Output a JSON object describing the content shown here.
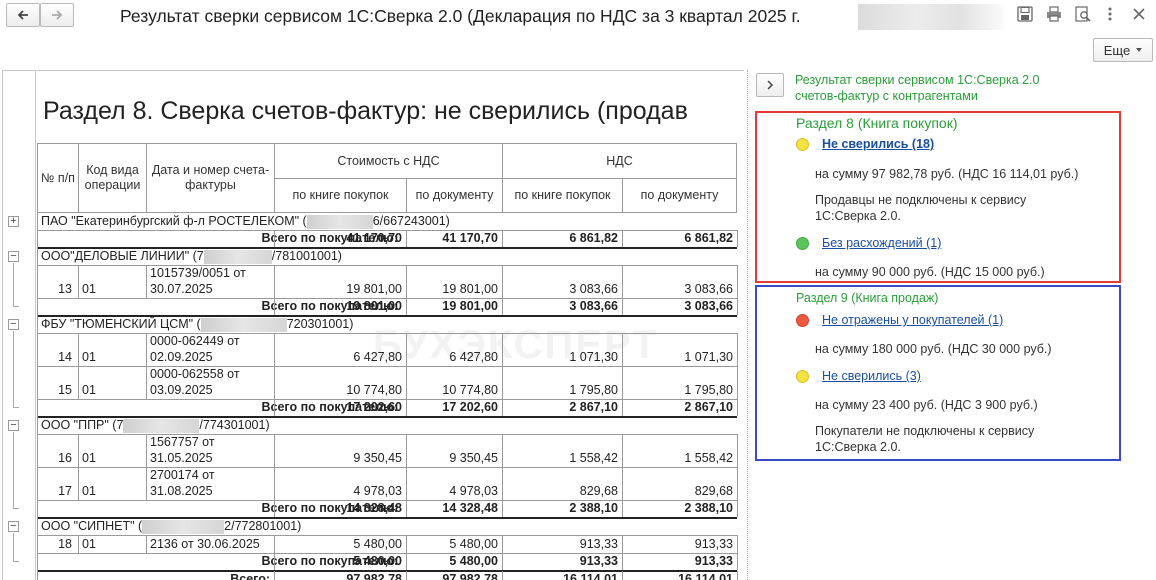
{
  "window": {
    "title": "Результат сверки сервисом 1С:Сверка 2.0 (Декларация по НДС за 3 квартал 2025 г.",
    "more_label": "Еще"
  },
  "report": {
    "title": "Раздел 8. Сверка счетов-фактур: не сверились (продав",
    "watermark": "БУХЭКСПЕРТ",
    "headers": {
      "num": "№ п/п",
      "code": "Код вида операции",
      "date_num": "Дата и номер счета-фактуры",
      "cost": "Стоимость с НДС",
      "vat": "НДС",
      "by_book": "по книге покупок",
      "by_doc": "по документу"
    },
    "groups": [
      {
        "name_pre": "ПАО \"Екатеринбургский ф-л РОСТЕЛЕКОМ\" (",
        "name_post": "6/667243001)",
        "rows": [],
        "total_label": "Всего по покупателю:",
        "total": [
          "41 170,70",
          "41 170,70",
          "6 861,82",
          "6 861,82"
        ]
      },
      {
        "name_pre": "ООО\"ДЕЛОВЫЕ ЛИНИИ\" (7",
        "name_post": "/781001001)",
        "rows": [
          {
            "n": "13",
            "code": "01",
            "doc": [
              "1015739/0051 от",
              "30.07.2025"
            ],
            "v": [
              "19 801,00",
              "19 801,00",
              "3 083,66",
              "3 083,66"
            ]
          }
        ],
        "total_label": "Всего по покупателю:",
        "total": [
          "19 801,00",
          "19 801,00",
          "3 083,66",
          "3 083,66"
        ]
      },
      {
        "name_pre": "ФБУ \"ТЮМЕНСКИЙ ЦСМ\" (",
        "name_post": "720301001)",
        "rows": [
          {
            "n": "14",
            "code": "01",
            "doc": [
              "0000-062449 от",
              "02.09.2025"
            ],
            "v": [
              "6 427,80",
              "6 427,80",
              "1 071,30",
              "1 071,30"
            ]
          },
          {
            "n": "15",
            "code": "01",
            "doc": [
              "0000-062558 от",
              "03.09.2025"
            ],
            "v": [
              "10 774,80",
              "10 774,80",
              "1 795,80",
              "1 795,80"
            ]
          }
        ],
        "total_label": "Всего по покупателю:",
        "total": [
          "17 202,60",
          "17 202,60",
          "2 867,10",
          "2 867,10"
        ]
      },
      {
        "name_pre": "ООО \"ППР\" (7",
        "name_post": "/774301001)",
        "rows": [
          {
            "n": "16",
            "code": "01",
            "doc": [
              "1567757 от",
              "31.05.2025"
            ],
            "v": [
              "9 350,45",
              "9 350,45",
              "1 558,42",
              "1 558,42"
            ]
          },
          {
            "n": "17",
            "code": "01",
            "doc": [
              "2700174 от",
              "31.08.2025"
            ],
            "v": [
              "4 978,03",
              "4 978,03",
              "829,68",
              "829,68"
            ]
          }
        ],
        "total_label": "Всего по покупателю:",
        "total": [
          "14 328,48",
          "14 328,48",
          "2 388,10",
          "2 388,10"
        ]
      },
      {
        "name_pre": "ООО \"СИПНЕТ\" (",
        "name_post": "2/772801001)",
        "rows": [
          {
            "n": "18",
            "code": "01",
            "doc": [
              "2136 от 30.06.2025"
            ],
            "v": [
              "5 480,00",
              "5 480,00",
              "913,33",
              "913,33"
            ]
          }
        ],
        "total_label": "Всего по покупателю:",
        "total": [
          "5 480,00",
          "5 480,00",
          "913,33",
          "913,33"
        ]
      }
    ],
    "grand_total_label": "Всего:",
    "grand_total": [
      "97 982,78",
      "97 982,78",
      "16 114,01",
      "16 114,01"
    ]
  },
  "side": {
    "header_line1": "Результат сверки сервисом 1С:Сверка 2.0",
    "header_line2": "счетов-фактур с контрагентами",
    "section8": {
      "title": "Раздел 8 (Книга покупок)",
      "items": [
        {
          "dot_color": "#f4e242",
          "link": "Не сверились (18)",
          "bold": true,
          "amount": "на сумму 97 982,78 руб. (НДС 16 114,01 руб.)",
          "note": [
            "Продавцы не подключены к сервису",
            "1С:Сверка 2.0."
          ]
        },
        {
          "dot_color": "#5cc45c",
          "link": "Без расхождений (1)",
          "bold": false,
          "amount": "на сумму 90 000 руб. (НДС 15 000 руб.)",
          "note": []
        }
      ]
    },
    "section9": {
      "title": "Раздел 9 (Книга продаж)",
      "items": [
        {
          "dot_color": "#ee5a3f",
          "link": "Не отражены у покупателей (1)",
          "bold": false,
          "amount": "на сумму 180 000 руб. (НДС 30 000 руб.)",
          "note": []
        },
        {
          "dot_color": "#f4e242",
          "link": "Не сверились (3)",
          "bold": false,
          "amount": "на сумму 23 400 руб. (НДС 3 900 руб.)",
          "note": [
            "Покупатели не подключены к сервису",
            "1С:Сверка 2.0."
          ]
        }
      ]
    },
    "colors": {
      "accent_green": "#2a9d3a",
      "link_blue": "#1a4fa0",
      "box_red": "#e53935",
      "box_blue": "#3949c7"
    }
  }
}
